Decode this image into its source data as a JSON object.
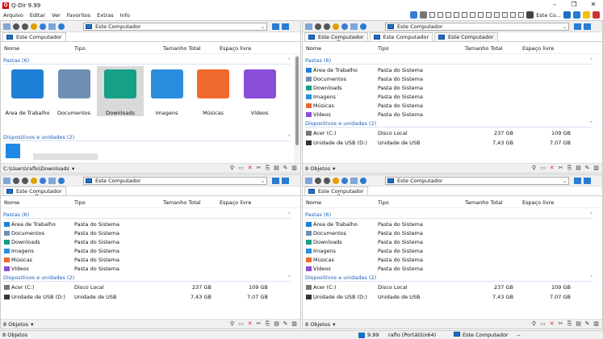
{
  "title": "Q-Dir 9.99",
  "menu": [
    "Arquivo",
    "Editar",
    "Ver",
    "Favoritos",
    "Extras",
    "Info"
  ],
  "menu_right_label": "Este Co...",
  "panes": {
    "tl": {
      "address": "Este Computador",
      "tabs": [
        "Este Computador"
      ],
      "columns": {
        "name": "Nome",
        "type": "Tipo",
        "size": "Tamanho Total",
        "free": "Espaço livre"
      },
      "folders_group": "Pastas (6)",
      "devices_group": "Dispositivos e unidades (2)",
      "big_icons": [
        {
          "label": "Área de Trabalho",
          "color": "#1e7fd6"
        },
        {
          "label": "Documentos",
          "color": "#6f8fb3"
        },
        {
          "label": "Downloads",
          "color": "#16a085"
        },
        {
          "label": "Imagens",
          "color": "#2a8ee0"
        },
        {
          "label": "Músicas",
          "color": "#f06a2e"
        },
        {
          "label": "Vídeos",
          "color": "#8a4fd8"
        }
      ],
      "status": "C:\\Users\\raflo\\Downloads"
    },
    "tr": {
      "address": "Este Computador",
      "tabs": [
        "Este Computador",
        "Este Computador",
        "Este Computador"
      ],
      "status": "8 Objetos"
    },
    "bl": {
      "address": "Este Computador",
      "tabs": [
        "Este Computador"
      ],
      "status": "8 Objetos"
    },
    "br": {
      "address": "Este Computador",
      "tabs": [
        "Este Computador"
      ],
      "status": "8 Objetos"
    }
  },
  "list": {
    "columns": {
      "name": "Nome",
      "type": "Tipo",
      "size": "Tamanho Total",
      "free": "Espaço livre"
    },
    "folders_group": "Pastas (6)",
    "devices_group": "Dispositivos e unidades (2)",
    "folders": [
      {
        "name": "Área de Trabalho",
        "type": "Pasta do Sistema",
        "icon_color": "#1e7fd6"
      },
      {
        "name": "Documentos",
        "type": "Pasta do Sistema",
        "icon_color": "#6f8fb3"
      },
      {
        "name": "Downloads",
        "type": "Pasta do Sistema",
        "icon_color": "#16a085"
      },
      {
        "name": "Imagens",
        "type": "Pasta do Sistema",
        "icon_color": "#2a8ee0"
      },
      {
        "name": "Músicas",
        "type": "Pasta do Sistema",
        "icon_color": "#f06a2e"
      },
      {
        "name": "Vídeos",
        "type": "Pasta do Sistema",
        "icon_color": "#8a4fd8"
      }
    ],
    "devices": [
      {
        "name": "Acer (C:)",
        "type": "Disco Local",
        "size": "237 GB",
        "free": "109 GB"
      },
      {
        "name": "Unidade de USB (D:)",
        "type": "Unidade de USB",
        "size": "7,43 GB",
        "free": "7,07 GB"
      }
    ]
  },
  "bottombar": {
    "objects": "8 Objetos",
    "version": "9.99",
    "user": "raflo (Portátil/x64)",
    "location": "Este Computador",
    "dashes": "--"
  }
}
